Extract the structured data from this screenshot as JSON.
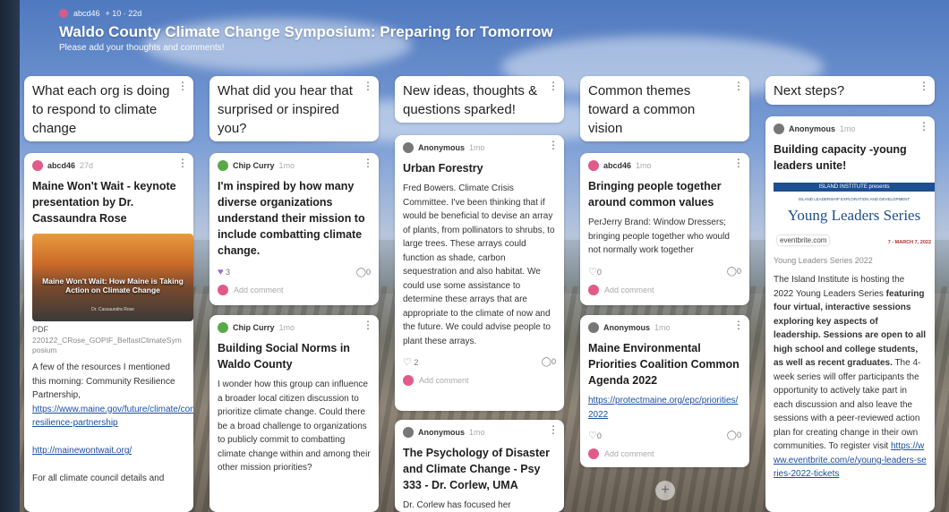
{
  "header": {
    "author": "abcd46",
    "stats": "+ 10 · 22d",
    "title": "Waldo County Climate Change Symposium: Preparing for Tomorrow",
    "subtitle": "Please add your thoughts and comments!"
  },
  "columns": [
    {
      "title": "What each org is doing to respond to climate change"
    },
    {
      "title": "What did you hear that surprised or inspired you?"
    },
    {
      "title": "New ideas, thoughts & questions sparked!"
    },
    {
      "title": "Common themes toward a common vision"
    },
    {
      "title": "Next steps?"
    }
  ],
  "cards": {
    "c1": {
      "author": "abcd46",
      "time": "27d",
      "title": "Maine Won't Wait - keynote presentation by Dr. Cassaundra Rose",
      "thumb_title": "Maine Won't Wait: How Maine is Taking Action on Climate Change",
      "thumb_sub": "Dr. Cassaundra Rose",
      "pdf": "PDF",
      "filename": "220122_CRose_GOPIF_BelfastClimateSymposium",
      "body1": "A few of the resources I mentioned this morning: Community Resilience Partnership,",
      "link1": "https://www.maine.gov/future/climate/community-resilience-partnership",
      "link2": "http://mainewontwait.org/",
      "body2": "For all climate council details and"
    },
    "c2": {
      "author": "Chip Curry",
      "time": "1mo",
      "title": "I'm inspired by how many diverse organizations understand their mission to include combatting climate change.",
      "likes": "3",
      "comments": "0",
      "add_comment": "Add comment"
    },
    "c3": {
      "author": "Chip Curry",
      "time": "1mo",
      "title": "Building Social Norms in Waldo County",
      "body": "I wonder how this group can influence a broader local citizen discussion to prioritize climate change.  Could there be a broad challenge to organizations to publicly commit to combatting climate change within and among their other mission priorities?"
    },
    "c4": {
      "author": "Anonymous",
      "time": "1mo",
      "title": "Urban Forestry",
      "body": "Fred Bowers. Climate Crisis Committee. I've been thinking that if would be beneficial to devise an array of plants, from pollinators to shrubs, to large trees. These arrays could function as shade, carbon sequestration and also habitat. We could use some assistance to determine these arrays that are appropriate to the climate of now and the future. We could advise people to plant these arrays.",
      "likes": "2",
      "comments": "0",
      "add_comment": "Add comment"
    },
    "c5": {
      "author": "Anonymous",
      "time": "1mo",
      "title": "The Psychology of Disaster and Climate Change - Psy 333 - Dr. Corlew, UMA",
      "body": "Dr. Corlew has focused her"
    },
    "c6": {
      "author": "abcd46",
      "time": "1mo",
      "title": "Bringing people together around common values",
      "body": "PerJerry Brand: Window Dressers; bringing people together who would not normally work together",
      "likes": "0",
      "comments": "0",
      "add_comment": "Add comment"
    },
    "c7": {
      "author": "Anonymous",
      "time": "1mo",
      "title": "Maine Environmental Priorities Coalition Common Agenda 2022",
      "link": "https://protectmaine.org/epc/priorities/2022",
      "likes": "0",
      "comments": "0",
      "add_comment": "Add comment"
    },
    "c8": {
      "author": "Anonymous",
      "time": "1mo",
      "title": "Building capacity -young leaders unite!",
      "banner_org": "ISLAND INSTITUTE presents",
      "banner_tag": "ISLAND LEADERSHIP EXPLORATION AND DEVELOPMENT",
      "banner_series": "Young Leaders Series",
      "banner_dates": "7 - MARCH 7, 2022",
      "source": "eventbrite.com",
      "caption": "Young Leaders Series 2022",
      "body_a": "The Island Institute is hosting the 2022 Young Leaders Series ",
      "body_b": "featuring four virtual, interactive sessions exploring key aspects of leadership. Sessions are open to all high school and college students, as well as recent graduates.",
      "body_c": " The 4-week series will offer participants the opportunity to actively take part in each discussion and also leave the sessions with a peer-reviewed action plan for creating change in their own communities. To register visit",
      "link": "https://www.eventbrite.com/e/young-leaders-series-2022-tickets"
    }
  },
  "add_button": "+"
}
